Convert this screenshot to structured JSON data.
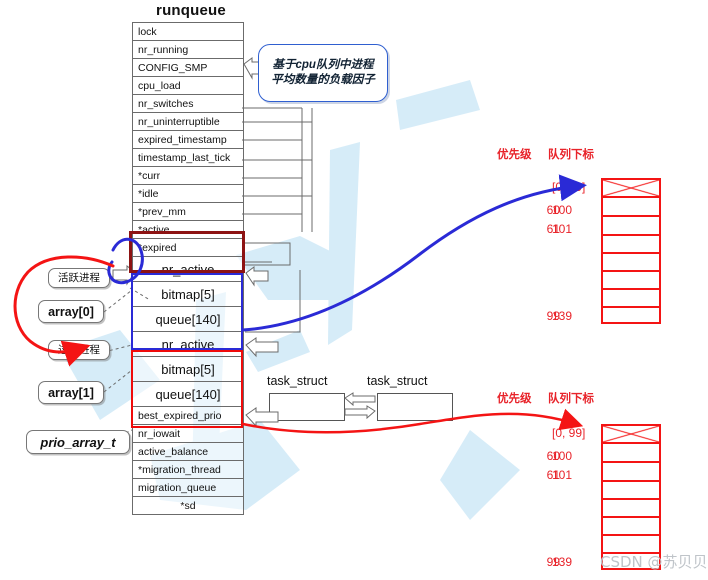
{
  "diagram": {
    "title": "runqueue",
    "watermark": "CSDN @苏贝贝"
  },
  "runqueue": {
    "title": "runqueue",
    "fields": [
      "lock",
      "nr_running",
      "CONFIG_SMP",
      "cpu_load",
      "nr_switches",
      "nr_uninterruptible",
      "expired_timestamp",
      "timestamp_last_tick",
      "*curr",
      "*idle",
      "*prev_mm",
      "*active",
      "*expired"
    ],
    "array0": [
      "nr_active",
      "bitmap[5]",
      "queue[140]"
    ],
    "array1": [
      "nr_active",
      "bitmap[5]",
      "queue[140]"
    ],
    "tail_fields": [
      "best_expired_prio",
      "nr_iowait",
      "active_balance",
      "*migration_thread",
      "migration_queue",
      "*sd"
    ]
  },
  "labels": {
    "active_processes": "活跃进程",
    "expired_processes": "过期进程",
    "array0": "array[0]",
    "array1": "array[1]",
    "prio_array_t": "prio_array_t"
  },
  "callout": {
    "line1": "基于cpu队列中进程",
    "line2": "平均数量的负载因子"
  },
  "task_structs": {
    "first": "task_struct",
    "second": "task_struct"
  },
  "priority_array_top": {
    "header_priority": "优先级",
    "header_index": "队列下标",
    "rows": [
      {
        "priority": "",
        "index": "[0, 99]"
      },
      {
        "priority": "60",
        "index": "100"
      },
      {
        "priority": "61",
        "index": "101"
      },
      {
        "priority": "99",
        "index": "139"
      }
    ],
    "cell_count": 8
  },
  "priority_array_bottom": {
    "header_priority": "优先级",
    "header_index": "队列下标",
    "rows": [
      {
        "priority": "",
        "index": "[0, 99]"
      },
      {
        "priority": "60",
        "index": "100"
      },
      {
        "priority": "61",
        "index": "101"
      },
      {
        "priority": "99",
        "index": "139"
      }
    ],
    "cell_count": 8
  },
  "colors": {
    "red": "#f41414",
    "blue": "#2a2ad6",
    "dark_red": "#8d1313",
    "callout_blue": "#2f5fd0",
    "label_red": "#e8232a"
  }
}
